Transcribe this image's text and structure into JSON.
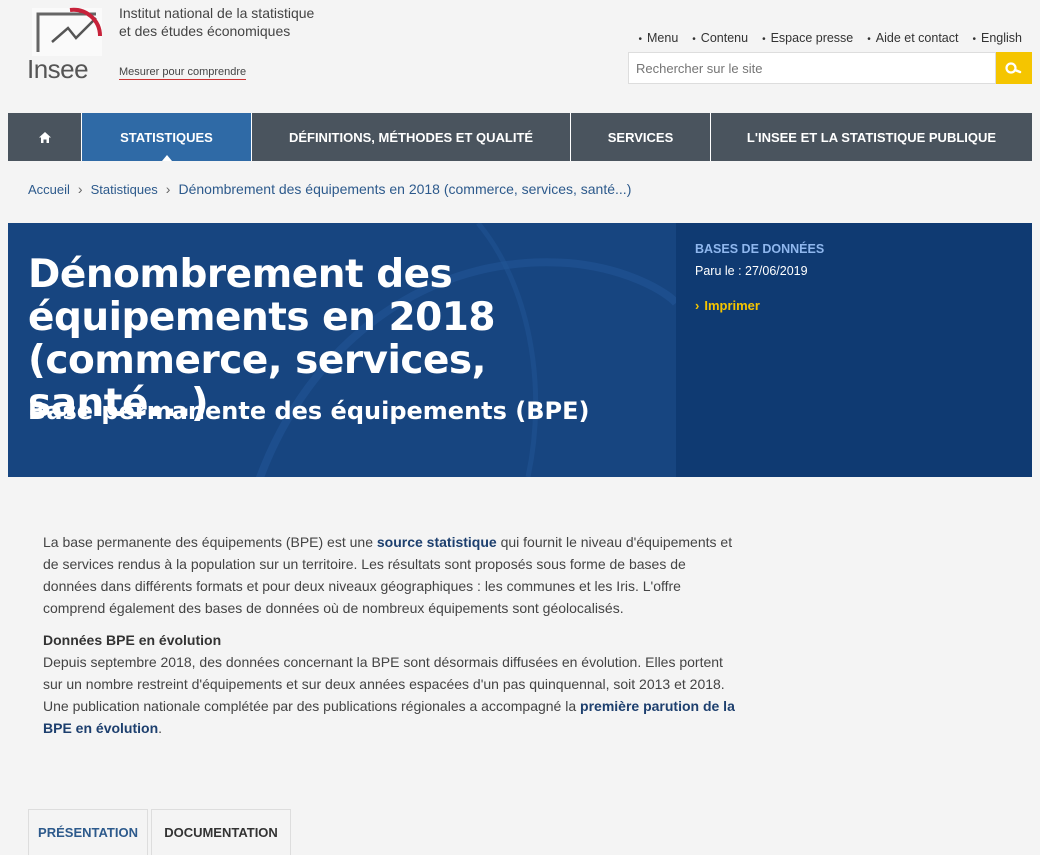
{
  "header": {
    "logo_text": "Insee",
    "institute_line1": "Institut national de la statistique",
    "institute_line2": "et des études économiques",
    "tagline": "Mesurer pour comprendre",
    "top_links": [
      "Menu",
      "Contenu",
      "Espace presse",
      "Aide et contact",
      "English"
    ],
    "search_placeholder": "Rechercher sur le site"
  },
  "nav": {
    "items": [
      "STATISTIQUES",
      "DÉFINITIONS, MÉTHODES ET QUALITÉ",
      "SERVICES",
      "L'INSEE ET LA STATISTIQUE PUBLIQUE"
    ]
  },
  "breadcrumb": [
    "Accueil",
    "Statistiques",
    "Dénombrement des équipements en 2018 (commerce, services, santé...)"
  ],
  "hero": {
    "title_line1": "Dénombrement des",
    "title_line2": "équipements en 2018",
    "title_line3": "(commerce, services, santé...)",
    "subtitle": "Base permanente des équipements (BPE)",
    "category": "BASES DE DONNÉES",
    "date": "Paru le : 27/06/2019",
    "print": "Imprimer"
  },
  "content": {
    "p1_before": "La base permanente des équipements (BPE) est une ",
    "p1_link": "source statistique",
    "p1_after": " qui fournit le niveau d'équipements et de services rendus à la population sur un territoire. Les résultats sont proposés sous forme de bases de données dans différents formats et pour deux niveaux géographiques : les communes et les Iris. L'offre comprend également des bases de données où de nombreux équipements sont géolocalisés.",
    "subhead": "Données BPE en évolution",
    "p2": "Depuis septembre 2018, des données concernant la BPE sont désormais diffusées en évolution. Elles portent sur un nombre restreint d'équipements et sur deux années espacées d'un pas quinquennal, soit 2013 et 2018.",
    "p3_before": "Une publication nationale complétée par des publications régionales a accompagné la ",
    "p3_link": "première parution de la BPE en évolution",
    "p3_after": "."
  },
  "tabs": [
    "PRÉSENTATION",
    "DOCUMENTATION"
  ],
  "colors": {
    "nav_bg": "#4a545e",
    "nav_active": "#2f6aa6",
    "hero_bg": "#174580",
    "accent_yellow": "#f5c500"
  }
}
